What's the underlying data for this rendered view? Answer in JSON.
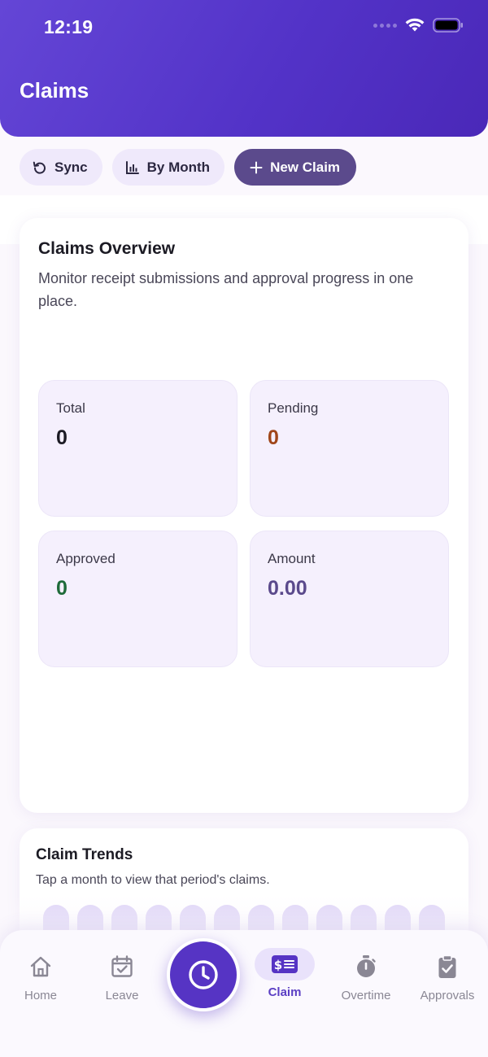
{
  "status_bar": {
    "time": "12:19"
  },
  "header": {
    "title": "Claims"
  },
  "toolbar": {
    "sync_label": "Sync",
    "by_month_label": "By Month",
    "new_claim_label": "New Claim"
  },
  "overview": {
    "title": "Claims Overview",
    "description": "Monitor receipt submissions and approval progress in one place.",
    "stats": [
      {
        "label": "Total",
        "value": "0",
        "color": "#1c1b24"
      },
      {
        "label": "Pending",
        "value": "0",
        "color": "#a0461a"
      },
      {
        "label": "Approved",
        "value": "0",
        "color": "#1f6b3a"
      },
      {
        "label": "Amount",
        "value": "0.00",
        "color": "#5b4a8c"
      }
    ]
  },
  "trends": {
    "title": "Claim Trends",
    "description": "Tap a month to view that period's claims."
  },
  "bottom_nav": {
    "items": [
      {
        "label": "Home",
        "icon": "home-icon"
      },
      {
        "label": "Leave",
        "icon": "calendar-check-icon"
      },
      {
        "label": "Claim",
        "icon": "dollar-receipt-icon",
        "active": true
      },
      {
        "label": "Overtime",
        "icon": "stopwatch-icon"
      },
      {
        "label": "Approvals",
        "icon": "clipboard-check-icon"
      }
    ],
    "center_action_icon": "clock-icon"
  },
  "colors": {
    "header_gradient_start": "#6446d6",
    "header_gradient_end": "#4a28b8",
    "accent": "#5634c4",
    "chip_bg": "#efe9fb",
    "primary_chip_bg": "#5b4a8c",
    "stat_card_bg": "#f5f0fd"
  }
}
